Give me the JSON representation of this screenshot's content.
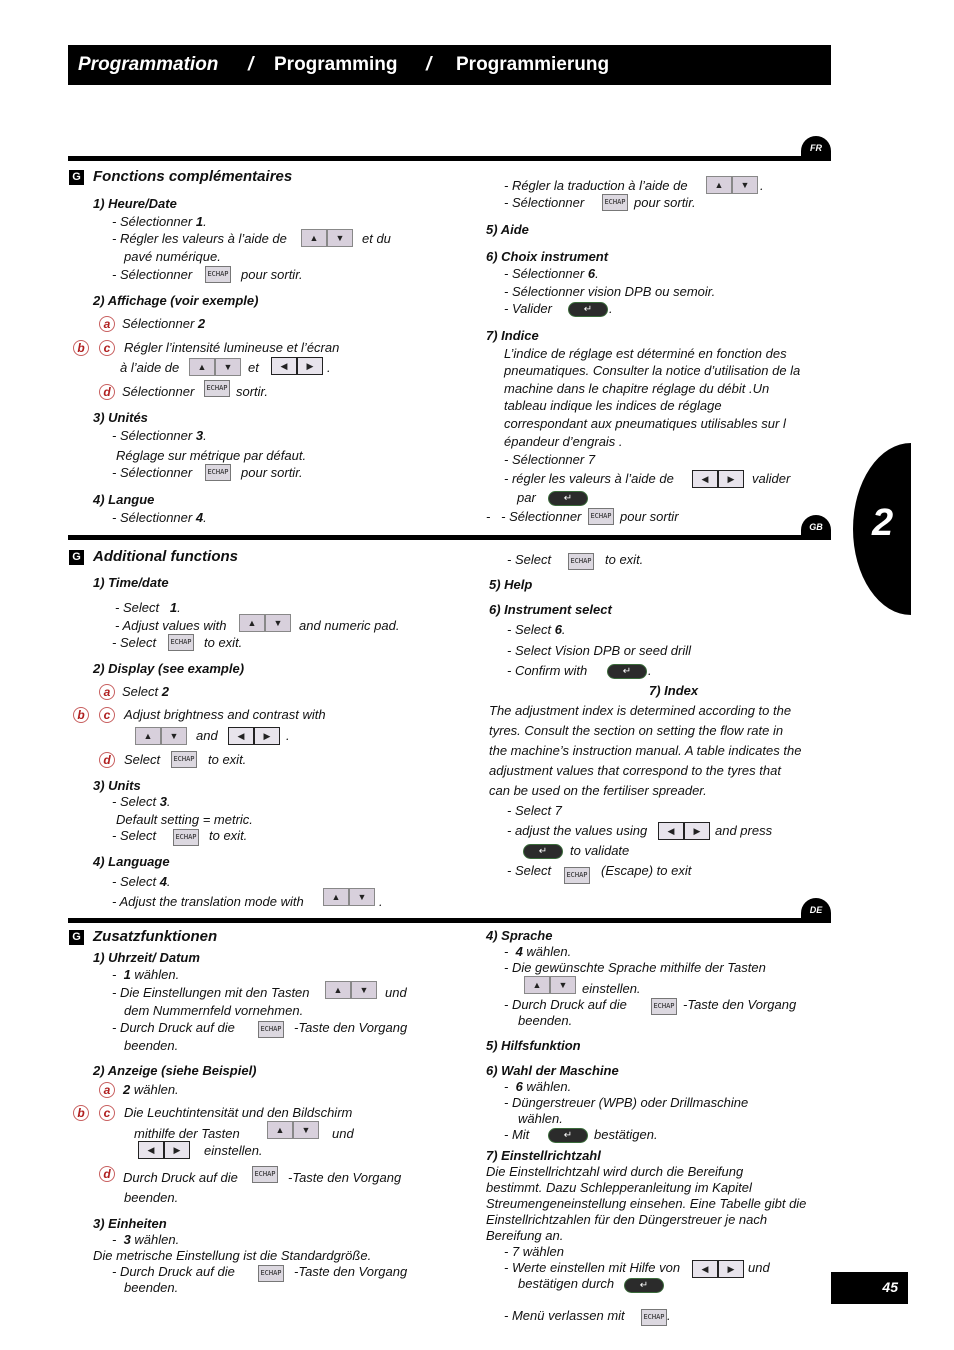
{
  "header": {
    "fr": "Programmation",
    "sep1": "/",
    "en": "Programming",
    "sep2": "/",
    "de": "Programmierung"
  },
  "chapter": "2",
  "page_number": "45",
  "lang_tabs": {
    "fr": "FR",
    "gb": "GB",
    "de": "DE"
  },
  "keys": {
    "echap": "ECHAP",
    "up": "▲",
    "down": "▼",
    "left": "◀",
    "right": "▶",
    "enter": "↵",
    "g": "G"
  },
  "fr": {
    "title": "Fonctions complémentaires",
    "s1": {
      "title": "1) Heure/Date",
      "l1": "- Sélectionner ",
      "l1b": "1",
      "l2a": "- Régler les valeurs à l’aide de",
      "l2b": "et du",
      "l3": "pavé numérique.",
      "l4a": "- Sélectionner",
      "l4b": "pour sortir."
    },
    "s2": {
      "title": "2) Affichage (voir exemple)",
      "a": "Sélectionner ",
      "ab": "2",
      "bc1": "Régler l’intensité lumineuse et l’écran",
      "bc2a": "à l’aide de",
      "bc2b": "et",
      "d_a": "Sélectionner",
      "d_b": "sortir."
    },
    "s3": {
      "title": "3) Unités",
      "l1": "- Sélectionner ",
      "l1b": "3",
      "l2": "Réglage sur métrique par défaut.",
      "l3a": "- Sélectionner",
      "l3b": "pour sortir."
    },
    "s4": {
      "title": "4) Langue",
      "l1": "- Sélectionner ",
      "l1b": "4",
      "l2a": "- Régler la traduction à l’aide de",
      "l3a": "- Sélectionner",
      "l3b": "pour sortir."
    },
    "s5": {
      "title": "5)  Aide"
    },
    "s6": {
      "title": "6) Choix instrument",
      "l1": "- Sélectionner ",
      "l1b": "6",
      "l2": "- Sélectionner vision DPB ou semoir.",
      "l3": "- Valider"
    },
    "s7": {
      "title": "7) Indice",
      "p": [
        "L’indice de réglage est déterminé en fonction des",
        "pneumatiques. Consulter la notice d’utilisation de la",
        "machine dans le chapitre réglage du débit .Un",
        "tableau indique les indices de réglage",
        "correspondant aux pneumatiques utilisables sur l",
        "épandeur d’engrais ."
      ],
      "l1": "- Sélectionner 7",
      "l2a": "- régler les valeurs à l’aide de",
      "l2b": "valider",
      "l3": "par",
      "l4a": "- Sélectionner",
      "l4b": "pour sortir"
    }
  },
  "en": {
    "title": "Additional functions",
    "s1": {
      "title": "1) Time/date",
      "l1": "- Select ",
      "l1b": "1",
      "l2a": "- Adjust values with",
      "l2b": "and numeric pad.",
      "l3a": "- Select",
      "l3b": "to exit."
    },
    "s2": {
      "title": "2) Display (see example)",
      "a": "Select ",
      "ab": "2",
      "bc1": "Adjust brightness and contrast with",
      "bc2": "and",
      "d_a": "Select",
      "d_b": "to exit."
    },
    "s3": {
      "title": "3) Units",
      "l1": "- Select ",
      "l1b": "3",
      "l2": "Default setting = metric.",
      "l3a": "- Select",
      "l3b": "to exit."
    },
    "s4": {
      "title": "4) Language",
      "l1": "- Select ",
      "l1b": "4",
      "l2a": "- Adjust the translation mode with",
      "l3a": "- Select",
      "l3b": "to exit."
    },
    "s5": {
      "title": "5) Help"
    },
    "s6": {
      "title": "6) Instrument select",
      "l1": "- Select ",
      "l1b": "6",
      "l2": "- Select Vision DPB or seed drill",
      "l3": "- Confirm with"
    },
    "s7": {
      "title": "7) Index",
      "p": [
        "The adjustment index is determined according to the",
        "tyres. Consult the section on setting the flow rate in",
        "the machine’s instruction manual. A table indicates the",
        "adjustment values that correspond to the tyres that",
        "can be used on the fertiliser spreader."
      ],
      "l1": "- Select 7",
      "l2a": "- adjust the values using",
      "l2b": "and press",
      "l3": "to validate",
      "l4a": "- Select",
      "l4b": "(Escape) to exit"
    }
  },
  "de": {
    "title": "Zusatzfunktionen",
    "s1": {
      "title": "1) Uhrzeit/ Datum",
      "l1b": "1",
      "l1": " wählen.",
      "l2a": "- Die Einstellungen mit den Tasten",
      "l2b": "und",
      "l3": "dem Nummernfeld vornehmen.",
      "l4a": "- Durch Druck auf die",
      "l4b": "-Taste den Vorgang",
      "l5": "beenden."
    },
    "s2": {
      "title": "2) Anzeige (siehe Beispiel)",
      "ab": "2",
      "a": " wählen.",
      "bc1": "Die Leuchtintensität und den Bildschirm",
      "bc2a": "mithilfe  der Tasten",
      "bc2b": "und",
      "bc3": "einstellen.",
      "d_a": "Durch Druck auf die",
      "d_b": "-Taste den Vorgang",
      "d_c": "beenden."
    },
    "s3": {
      "title": "3) Einheiten",
      "l1b": "3",
      "l1": " wählen.",
      "l2": "Die metrische Einstellung ist die Standardgröße.",
      "l3a": "- Durch Druck auf die",
      "l3b": "-Taste den Vorgang",
      "l4": "beenden."
    },
    "s4": {
      "title": "4) Sprache",
      "l1b": "4",
      "l1": " wählen.",
      "l2": "- Die gewünschte Sprache mithilfe der Tasten",
      "l3": "einstellen.",
      "l4a": "- Durch Druck auf die",
      "l4b": "-Taste den Vorgang",
      "l5": "beenden."
    },
    "s5": {
      "title": "5) Hilfsfunktion"
    },
    "s6": {
      "title": "6) Wahl der Maschine",
      "l1b": "6",
      "l1": " wählen.",
      "l2": "- Düngerstreuer (WPB) oder Drillmaschine",
      "l3": "wählen.",
      "l4a": "- Mit",
      "l4b": "bestätigen."
    },
    "s7": {
      "title": "7) Einstellrichtzahl",
      "p": [
        "Die Einstellrichtzahl wird durch die Bereifung",
        "bestimmt. Dazu Schlepperanleitung im Kapitel",
        "Streumengeneinstellung einsehen. Eine Tabelle gibt die",
        "Einstellrichtzahlen für den Düngerstreuer je nach",
        "Bereifung an."
      ],
      "l1": "- 7 wählen",
      "l2a": "- Werte einstellen mit Hilfe von",
      "l2b": "und",
      "l3": "bestätigen durch",
      "l4": "- Menü verlassen mit",
      "l4b": "."
    }
  }
}
